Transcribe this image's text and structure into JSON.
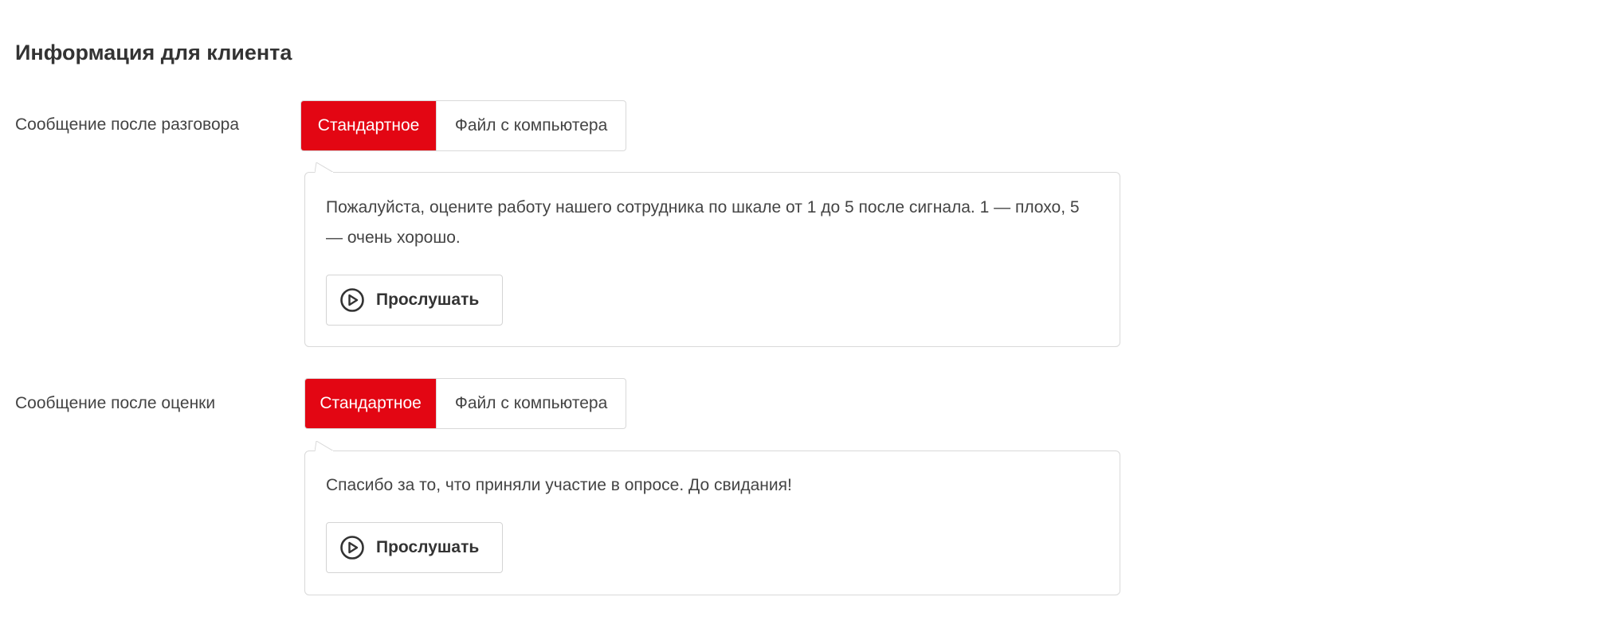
{
  "section": {
    "title": "Информация для клиента"
  },
  "rows": [
    {
      "label": "Сообщение после разговора",
      "tabs": {
        "standard": "Стандартное",
        "file": "Файл с компьютера"
      },
      "selected_tab": "Стандартное",
      "message": "Пожалуйста, оцените работу нашего сотрудника по шкале от 1 до 5 после сигнала. 1 — плохо, 5 — очень хорошо.",
      "listen_label": "Прослушать"
    },
    {
      "label": "Сообщение после оценки",
      "tabs": {
        "standard": "Стандартное",
        "file": "Файл с компьютера"
      },
      "selected_tab": "Стандартное",
      "message": "Спасибо за то, что приняли участие в опросе. До свидания!",
      "listen_label": "Прослушать"
    }
  ],
  "colors": {
    "accent": "#e30613",
    "border": "#d9d9d9",
    "text": "#333333"
  },
  "icons": {
    "listen": "play-circle-icon"
  }
}
